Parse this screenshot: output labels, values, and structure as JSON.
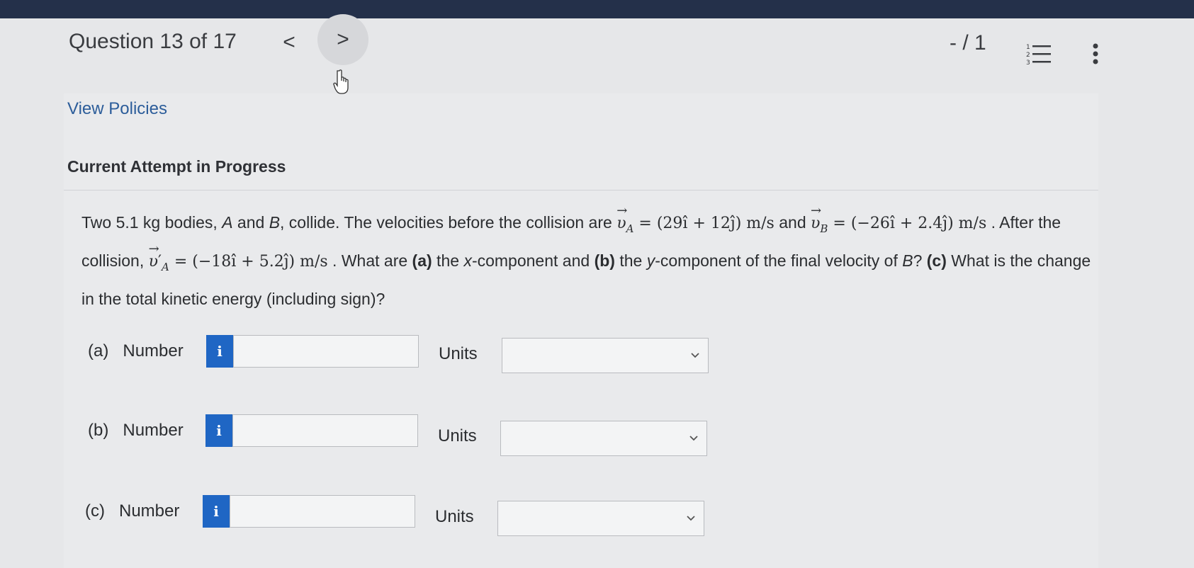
{
  "header": {
    "question_title": "Question 13 of 17",
    "prev_glyph": "<",
    "next_glyph": ">",
    "score": "- / 1"
  },
  "links": {
    "view_policies": "View Policies"
  },
  "attempt": {
    "status": "Current Attempt in Progress"
  },
  "problem": {
    "part1": "Two 5.1 kg bodies, ",
    "A": "A",
    "part2": " and ",
    "B": "B",
    "part3": ", collide. The velocities before the collision are ",
    "vA_value": "= (29î + 12ĵ) m/s",
    "and": " and ",
    "vB_value": "= (−26î + 2.4ĵ) m/s",
    "part4": " . After the collision, ",
    "vA_prime_value": "= (−18î + 5.2ĵ) m/s",
    "part5": " . What are ",
    "a_tag": "(a)",
    "part6": " the ",
    "x": "x",
    "part7": "-component and ",
    "b_tag": "(b)",
    "part8": " the ",
    "y": "y",
    "part9": "-component of the final velocity of ",
    "B2": "B",
    "part10": "? ",
    "c_tag": "(c)",
    "part11": " What is the change in the total kinetic energy (including sign)?"
  },
  "answers": [
    {
      "tag": "(a)",
      "label": "Number",
      "info_glyph": "i",
      "value": "",
      "units_label": "Units",
      "units_value": ""
    },
    {
      "tag": "(b)",
      "label": "Number",
      "info_glyph": "i",
      "value": "",
      "units_label": "Units",
      "units_value": ""
    },
    {
      "tag": "(c)",
      "label": "Number",
      "info_glyph": "i",
      "value": "",
      "units_label": "Units",
      "units_value": ""
    }
  ],
  "icons": [
    "chevron-left-icon",
    "chevron-right-icon",
    "hand-cursor-icon",
    "numbered-list-icon",
    "more-vertical-icon",
    "info-icon",
    "chevron-down-icon"
  ],
  "colors": {
    "topbar": "#24304a",
    "link": "#2c5d9a",
    "info_button": "#1f66c4",
    "background": "#e6e7e9"
  }
}
